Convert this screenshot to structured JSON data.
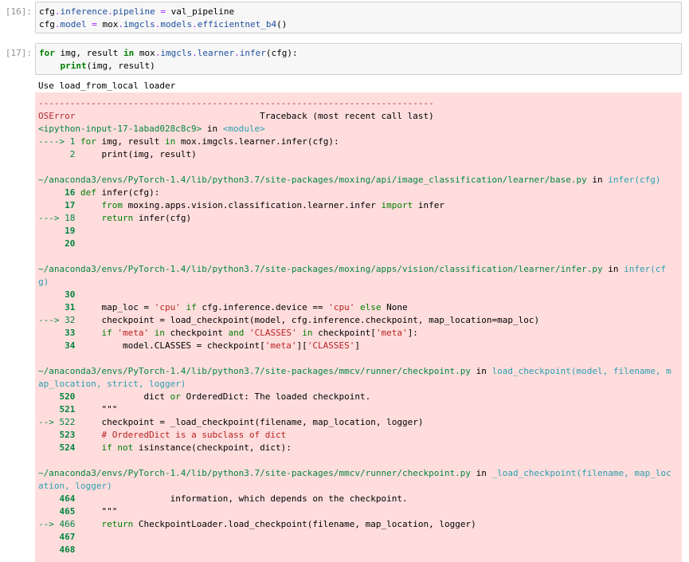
{
  "cells": {
    "c16": {
      "prompt": "[16]:",
      "lines": [
        [
          [
            "",
            "cfg"
          ],
          [
            "op",
            "."
          ],
          [
            "attr",
            "inference"
          ],
          [
            "op",
            "."
          ],
          [
            "attr",
            "pipeline"
          ],
          [
            "",
            " "
          ],
          [
            "op",
            "="
          ],
          [
            "",
            " val_pipeline"
          ]
        ],
        [
          [
            "",
            "cfg"
          ],
          [
            "op",
            "."
          ],
          [
            "attr",
            "model"
          ],
          [
            "",
            " "
          ],
          [
            "op",
            "="
          ],
          [
            "",
            " mox"
          ],
          [
            "op",
            "."
          ],
          [
            "attr",
            "imgcls"
          ],
          [
            "op",
            "."
          ],
          [
            "attr",
            "models"
          ],
          [
            "op",
            "."
          ],
          [
            "attr",
            "efficientnet_b4"
          ],
          [
            "",
            "()"
          ]
        ]
      ]
    },
    "c17": {
      "prompt": "[17]:",
      "lines": [
        [
          [
            "kw",
            "for"
          ],
          [
            "",
            " img, result "
          ],
          [
            "kw",
            "in"
          ],
          [
            "",
            " mox"
          ],
          [
            "op",
            "."
          ],
          [
            "attr",
            "imgcls"
          ],
          [
            "op",
            "."
          ],
          [
            "attr",
            "learner"
          ],
          [
            "op",
            "."
          ],
          [
            "attr",
            "infer"
          ],
          [
            "",
            "(cfg):"
          ]
        ],
        [
          [
            "",
            "    "
          ],
          [
            "kw-plain",
            "print"
          ],
          [
            "",
            "(img, result)"
          ]
        ]
      ],
      "stdout": "Use load_from_local loader"
    }
  },
  "traceback": [
    [
      [
        "t-red",
        "---------------------------------------------------------------------------"
      ]
    ],
    [
      [
        "t-red",
        "OSError"
      ],
      [
        "",
        "                                   Traceback (most recent call last)"
      ]
    ],
    [
      [
        "t-green",
        "<ipython-input-17-1abad028c8c9>"
      ],
      [
        "",
        " in "
      ],
      [
        "t-cyan2",
        "<module>"
      ]
    ],
    [
      [
        "t-green",
        "----> 1 "
      ],
      [
        "t-kw",
        "for"
      ],
      [
        "",
        " img"
      ],
      [
        "",
        ","
      ],
      [
        "",
        " result "
      ],
      [
        "t-kw",
        "in"
      ],
      [
        "",
        " mox"
      ],
      [
        "",
        "."
      ],
      [
        "",
        "imgcls"
      ],
      [
        "",
        "."
      ],
      [
        "",
        "learner"
      ],
      [
        "",
        "."
      ],
      [
        "",
        "infer"
      ],
      [
        "",
        "(cfg):"
      ]
    ],
    [
      [
        "t-green",
        "      2 "
      ],
      [
        "",
        "    print"
      ],
      [
        "",
        "(img"
      ],
      [
        "",
        ","
      ],
      [
        "",
        " result)"
      ]
    ],
    [],
    [
      [
        "t-green",
        "~/anaconda3/envs/PyTorch-1.4/lib/python3.7/site-packages/moxing/api/image_classification/learner/base.py"
      ],
      [
        "",
        " in "
      ],
      [
        "t-cyan2",
        "infer(cfg)"
      ]
    ],
    [
      [
        "t-green t-bold",
        "     16 "
      ],
      [
        "t-kw",
        "def"
      ],
      [
        "",
        " infer"
      ],
      [
        "",
        "(cfg):"
      ]
    ],
    [
      [
        "t-green t-bold",
        "     17 "
      ],
      [
        "",
        "    "
      ],
      [
        "t-kw",
        "from"
      ],
      [
        "",
        " moxing.apps.vision.classification.learner.infer "
      ],
      [
        "t-kw",
        "import"
      ],
      [
        "",
        " infer"
      ]
    ],
    [
      [
        "t-green",
        "---> 18 "
      ],
      [
        "",
        "    "
      ],
      [
        "t-kw",
        "return"
      ],
      [
        "",
        " infer(cfg)"
      ]
    ],
    [
      [
        "t-green t-bold",
        "     19 "
      ]
    ],
    [
      [
        "t-green t-bold",
        "     20 "
      ]
    ],
    [],
    [
      [
        "t-green",
        "~/anaconda3/envs/PyTorch-1.4/lib/python3.7/site-packages/moxing/apps/vision/classification/learner/infer.py"
      ],
      [
        "",
        " in "
      ],
      [
        "t-cyan2",
        "infer(cf"
      ]
    ],
    [
      [
        "t-cyan2",
        "g)"
      ]
    ],
    [
      [
        "t-green t-bold",
        "     30 "
      ]
    ],
    [
      [
        "t-green t-bold",
        "     31 "
      ],
      [
        "",
        "    map_loc = "
      ],
      [
        "str",
        "'cpu'"
      ],
      [
        "",
        " "
      ],
      [
        "t-kw",
        "if"
      ],
      [
        "",
        " cfg.inference.device "
      ],
      [
        "",
        "=="
      ],
      [
        "",
        " "
      ],
      [
        "str",
        "'cpu'"
      ],
      [
        "",
        " "
      ],
      [
        "t-kw",
        "else"
      ],
      [
        "",
        " None"
      ]
    ],
    [
      [
        "t-green",
        "---> 32 "
      ],
      [
        "",
        "    checkpoint = load_checkpoint(model, cfg.inference.checkpoint, map_location=map_loc)"
      ]
    ],
    [
      [
        "t-green t-bold",
        "     33 "
      ],
      [
        "",
        "    "
      ],
      [
        "t-kw",
        "if"
      ],
      [
        "",
        " "
      ],
      [
        "str",
        "'meta'"
      ],
      [
        "",
        " "
      ],
      [
        "t-kw",
        "in"
      ],
      [
        "",
        " checkpoint "
      ],
      [
        "t-kw",
        "and"
      ],
      [
        "",
        " "
      ],
      [
        "str",
        "'CLASSES'"
      ],
      [
        "",
        " "
      ],
      [
        "t-kw",
        "in"
      ],
      [
        "",
        " checkpoint["
      ],
      [
        "str",
        "'meta'"
      ],
      [
        "",
        "]:"
      ]
    ],
    [
      [
        "t-green t-bold",
        "     34 "
      ],
      [
        "",
        "        model.CLASSES = checkpoint["
      ],
      [
        "str",
        "'meta'"
      ],
      [
        "",
        "]["
      ],
      [
        "str",
        "'CLASSES'"
      ],
      [
        "",
        "]"
      ]
    ],
    [],
    [
      [
        "t-green",
        "~/anaconda3/envs/PyTorch-1.4/lib/python3.7/site-packages/mmcv/runner/checkpoint.py"
      ],
      [
        "",
        " in "
      ],
      [
        "t-cyan2",
        "load_checkpoint(model, filename, m"
      ]
    ],
    [
      [
        "t-cyan2",
        "ap_location, strict, logger)"
      ]
    ],
    [
      [
        "t-green t-bold",
        "    520 "
      ],
      [
        "",
        "            dict "
      ],
      [
        "t-kw",
        "or"
      ],
      [
        "",
        " OrderedDict: The loaded checkpoint."
      ]
    ],
    [
      [
        "t-green t-bold",
        "    521 "
      ],
      [
        "",
        "    \"\"\""
      ]
    ],
    [
      [
        "t-green",
        "--> 522 "
      ],
      [
        "",
        "    checkpoint = _load_checkpoint(filename, map_location, logger)"
      ]
    ],
    [
      [
        "t-green t-bold",
        "    523 "
      ],
      [
        "",
        "    "
      ],
      [
        "str",
        "# OrderedDict is a subclass of dict"
      ]
    ],
    [
      [
        "t-green t-bold",
        "    524 "
      ],
      [
        "",
        "    "
      ],
      [
        "t-kw",
        "if"
      ],
      [
        "",
        " "
      ],
      [
        "t-kw",
        "not"
      ],
      [
        "",
        " isinstance(checkpoint, dict):"
      ]
    ],
    [],
    [
      [
        "t-green",
        "~/anaconda3/envs/PyTorch-1.4/lib/python3.7/site-packages/mmcv/runner/checkpoint.py"
      ],
      [
        "",
        " in "
      ],
      [
        "t-cyan2",
        "_load_checkpoint(filename, map_loc"
      ]
    ],
    [
      [
        "t-cyan2",
        "ation, logger)"
      ]
    ],
    [
      [
        "t-green t-bold",
        "    464 "
      ],
      [
        "",
        "                 information, which depends on the checkpoint."
      ]
    ],
    [
      [
        "t-green t-bold",
        "    465 "
      ],
      [
        "",
        "    \"\"\""
      ]
    ],
    [
      [
        "t-green",
        "--> 466 "
      ],
      [
        "",
        "    "
      ],
      [
        "t-kw",
        "return"
      ],
      [
        "",
        " CheckpointLoader.load_checkpoint(filename, map_location, logger)"
      ]
    ],
    [
      [
        "t-green t-bold",
        "    467 "
      ]
    ],
    [
      [
        "t-green t-bold",
        "    468 "
      ]
    ]
  ]
}
